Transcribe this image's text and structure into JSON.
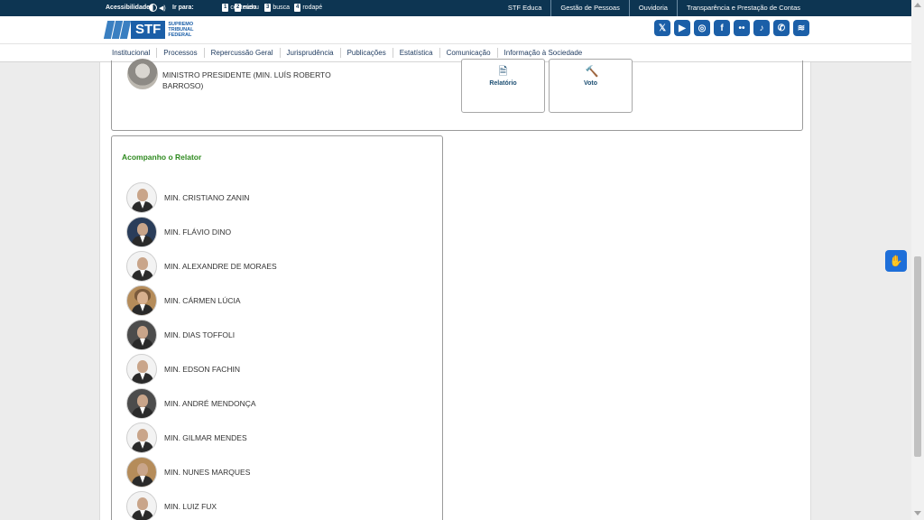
{
  "topbar": {
    "accessibility": "Acessibilidade",
    "go_to": "Ir para:",
    "jumps": [
      {
        "key": "1",
        "label": "conteúdo"
      },
      {
        "key": "2",
        "label": "menu"
      },
      {
        "key": "3",
        "label": "busca"
      },
      {
        "key": "4",
        "label": "rodapé"
      }
    ],
    "links": [
      "STF Educa",
      "Gestão de Pessoas",
      "Ouvidoria",
      "Transparência e Prestação de Contas"
    ]
  },
  "header": {
    "logo_text": "STF",
    "logo_sub": [
      "SUPREMO",
      "TRIBUNAL",
      "FEDERAL"
    ],
    "social": [
      "x-icon",
      "youtube-icon",
      "instagram-icon",
      "facebook-icon",
      "flickr-icon",
      "tiktok-icon",
      "whatsapp-icon",
      "spotify-icon"
    ]
  },
  "nav": [
    "Institucional",
    "Processos",
    "Repercussão Geral",
    "Jurisprudência",
    "Publicações",
    "Estatística",
    "Comunicação",
    "Informação à Sociedade"
  ],
  "president": {
    "name": "MINISTRO PRESIDENTE (MIN. LUÍS ROBERTO BARROSO)",
    "tiles": [
      {
        "label": "Relatório",
        "icon": "document-icon"
      },
      {
        "label": "Voto",
        "icon": "gavel-icon"
      }
    ]
  },
  "group": {
    "title": "Acompanho o Relator",
    "ministers": [
      "MIN. CRISTIANO ZANIN",
      "MIN. FLÁVIO DINO",
      "MIN. ALEXANDRE DE MORAES",
      "MIN. CÁRMEN LÚCIA",
      "MIN. DIAS TOFFOLI",
      "MIN. EDSON FACHIN",
      "MIN. ANDRÉ MENDONÇA",
      "MIN. GILMAR MENDES",
      "MIN. NUNES MARQUES",
      "MIN. LUIZ FUX"
    ]
  },
  "colors": {
    "topbar": "#0d3552",
    "brand": "#1b5fa8",
    "group_title": "#2e8a1f",
    "vlibras": "#1e6fd9"
  }
}
